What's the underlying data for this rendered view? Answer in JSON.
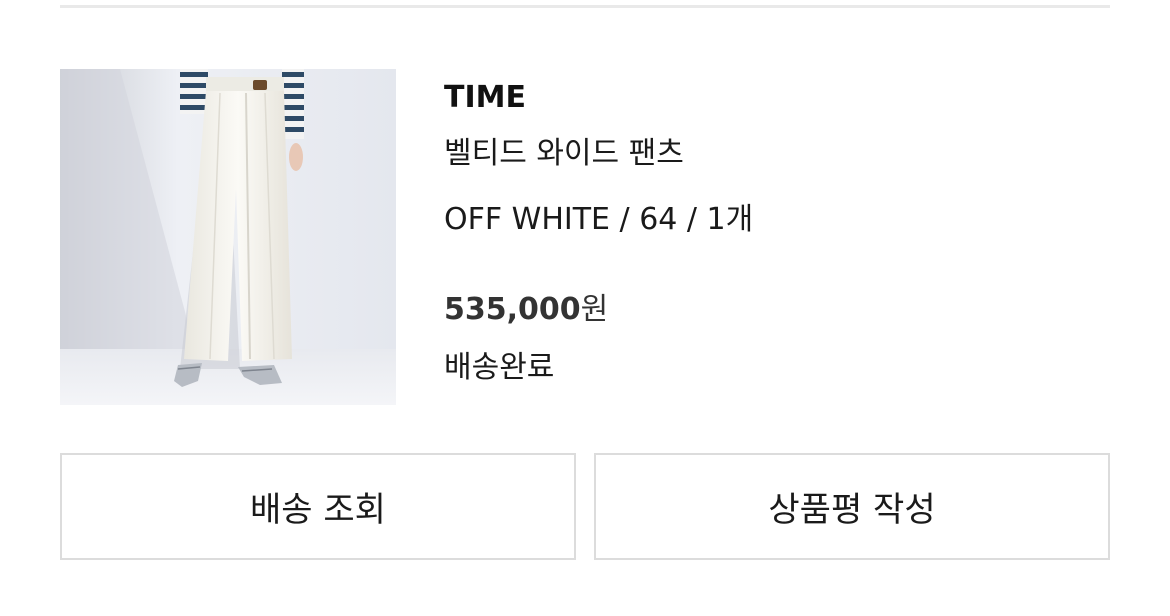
{
  "order_item": {
    "brand": "TIME",
    "product_name": "벨티드 와이드 팬츠",
    "option": "OFF WHITE / 64 / 1개",
    "price_amount": "535,000",
    "price_currency": "원",
    "status": "배송완료",
    "image_icon": "product-photo"
  },
  "actions": {
    "track_delivery_label": "배송 조회",
    "write_review_label": "상품평 작성"
  }
}
